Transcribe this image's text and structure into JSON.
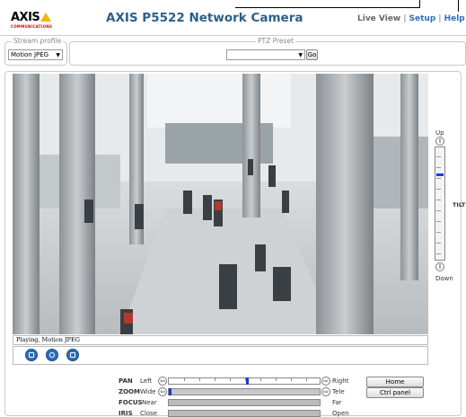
{
  "header": {
    "logo_text": "AXIS",
    "logo_sub": "COMMUNICATIONS",
    "title": "AXIS P5522 Network Camera",
    "nav": [
      {
        "label": "Live View"
      },
      {
        "label": "Setup"
      },
      {
        "label": "Help"
      }
    ],
    "nav_sep": "|"
  },
  "stream_profile": {
    "legend": "Stream profile",
    "value": "Motion JPEG"
  },
  "ptz_preset": {
    "legend": "PTZ Preset",
    "value": "",
    "go_label": "Go"
  },
  "video": {
    "status_text": "Playing, Motion JPEG"
  },
  "tilt": {
    "up_label": "Up",
    "down_label": "Down",
    "title": "TILT",
    "position": 0.24
  },
  "ptz_controls": [
    {
      "name": "PAN",
      "min": "Left",
      "max": "Right",
      "position": 0.52,
      "active": true
    },
    {
      "name": "ZOOM",
      "min": "Wide",
      "max": "Tele",
      "position": 0.0,
      "active": true
    },
    {
      "name": "FOCUS",
      "min": "Near",
      "max": "Far",
      "position": null,
      "active": false
    },
    {
      "name": "IRIS",
      "min": "Close",
      "max": "Open",
      "position": null,
      "active": false
    }
  ],
  "buttons": {
    "home": "Home",
    "ctrl_panel": "Ctrl panel"
  },
  "colors": {
    "title_blue": "#2b5f8a",
    "link_blue": "#2a6ebb",
    "slider_thumb": "#1a3bd6",
    "logo_yellow": "#f5b800"
  }
}
